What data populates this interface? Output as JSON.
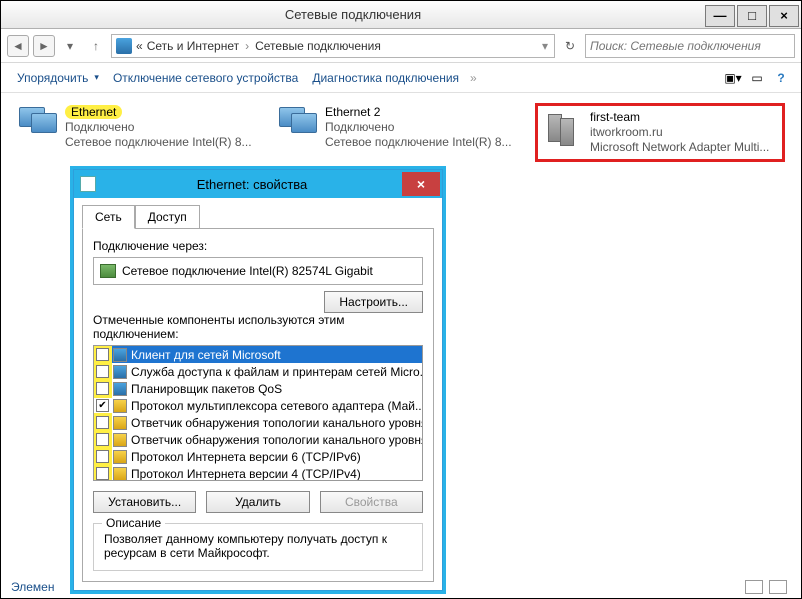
{
  "window": {
    "title": "Сетевые подключения",
    "min": "—",
    "max": "□",
    "close": "×"
  },
  "addr": {
    "back": "◄",
    "fwd": "►",
    "up": "↑",
    "sep": "›",
    "root": "«",
    "path1": "Сеть и Интернет",
    "path2": "Сетевые подключения",
    "refresh": "↻",
    "search_placeholder": "Поиск: Сетевые подключения"
  },
  "toolbar": {
    "organize": "Упорядочить",
    "disable": "Отключение сетевого устройства",
    "diag": "Диагностика подключения",
    "more": "»"
  },
  "view_icons": {
    "layout": "▣▾",
    "pane": "▭",
    "help": "?"
  },
  "conn": [
    {
      "name": "Ethernet",
      "sub1": "Подключено",
      "sub2": "Сетевое подключение Intel(R) 8..."
    },
    {
      "name": "Ethernet 2",
      "sub1": "Подключено",
      "sub2": "Сетевое подключение Intel(R) 8..."
    },
    {
      "name": "first-team",
      "sub1": "itworkroom.ru",
      "sub2": "Microsoft Network Adapter Multi..."
    }
  ],
  "dialog": {
    "title": "Ethernet: свойства",
    "close": "×",
    "tab1": "Сеть",
    "tab2": "Доступ",
    "connect_via": "Подключение через:",
    "adapter": "Сетевое подключение Intel(R) 82574L Gigabit",
    "configure": "Настроить...",
    "components_label": "Отмеченные компоненты используются этим подключением:",
    "install": "Установить...",
    "uninstall": "Удалить",
    "properties": "Свойства",
    "desc_label": "Описание",
    "desc_text": "Позволяет данному компьютеру получать доступ к ресурсам в сети Майкрософт."
  },
  "components": [
    {
      "checked": false,
      "hl": true,
      "sel": true,
      "cls": "net",
      "label": "Клиент для сетей Microsoft"
    },
    {
      "checked": false,
      "hl": true,
      "sel": false,
      "cls": "net",
      "label": "Служба доступа к файлам и принтерам сетей Micro..."
    },
    {
      "checked": false,
      "hl": true,
      "sel": false,
      "cls": "net",
      "label": "Планировщик пакетов QoS"
    },
    {
      "checked": true,
      "hl": false,
      "sel": false,
      "cls": "yel",
      "label": "Протокол мультиплексора сетевого адаптера (Май..."
    },
    {
      "checked": false,
      "hl": true,
      "sel": false,
      "cls": "yel",
      "label": "Ответчик обнаружения топологии канального уровня"
    },
    {
      "checked": false,
      "hl": true,
      "sel": false,
      "cls": "yel",
      "label": "Ответчик обнаружения топологии канального уровня"
    },
    {
      "checked": false,
      "hl": true,
      "sel": false,
      "cls": "yel",
      "label": "Протокол Интернета версии 6 (TCP/IPv6)"
    },
    {
      "checked": false,
      "hl": true,
      "sel": false,
      "cls": "yel",
      "label": "Протокол Интернета версии 4 (TCP/IPv4)"
    }
  ],
  "status": "Элемен"
}
